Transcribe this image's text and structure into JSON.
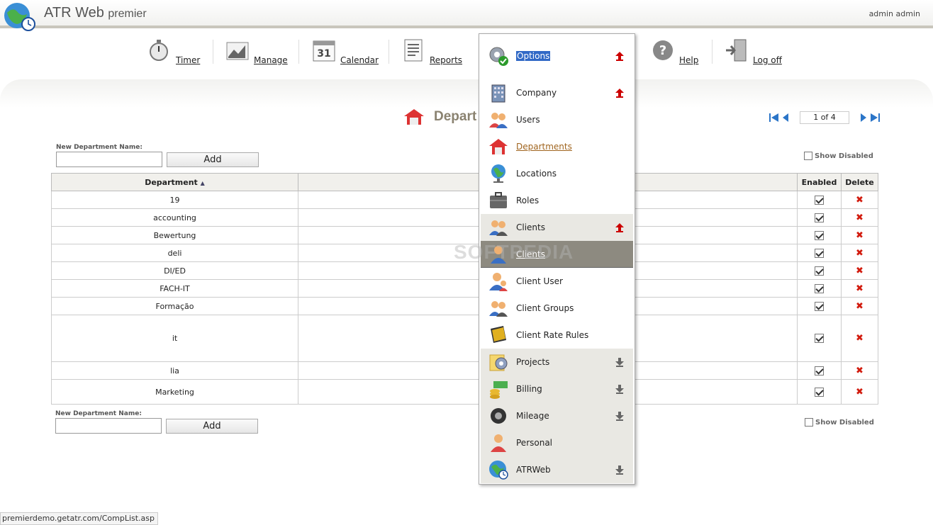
{
  "app": {
    "title": "ATR Web",
    "title_suffix": "premier",
    "user": "admin admin"
  },
  "nav": [
    {
      "label": "Timer",
      "icon": "stopwatch-icon"
    },
    {
      "label": "Manage",
      "icon": "chart-icon"
    },
    {
      "label": "Calendar",
      "icon": "calendar-icon",
      "icon_text": "31"
    },
    {
      "label": "Reports",
      "icon": "report-icon"
    },
    {
      "label": "Help",
      "icon": "help-icon",
      "icon_text": "?"
    },
    {
      "label": "Log off",
      "icon": "logoff-icon"
    }
  ],
  "page": {
    "title": "Depart",
    "pager_text": "1 of 4"
  },
  "form_top": {
    "label": "New Department Name:",
    "value": "",
    "add_label": "Add",
    "show_disabled": "Show Disabled"
  },
  "form_bottom": {
    "label": "New Department Name:",
    "value": "",
    "add_label": "Add",
    "show_disabled": "Show Disabled"
  },
  "table": {
    "headers": {
      "department": "Department",
      "enabled": "Enabled",
      "delete": "Delete"
    },
    "sort_indicator": "▲",
    "rows": [
      {
        "name": "19",
        "enabled": true,
        "delete": "✖"
      },
      {
        "name": "accounting",
        "enabled": true,
        "delete": "✖"
      },
      {
        "name": "Bewertung",
        "enabled": true,
        "delete": "✖"
      },
      {
        "name": "deli",
        "enabled": true,
        "delete": "✖"
      },
      {
        "name": "DI/ED",
        "enabled": true,
        "delete": "✖"
      },
      {
        "name": "FACH-IT",
        "enabled": true,
        "delete": "✖"
      },
      {
        "name": "Formação",
        "enabled": true,
        "delete": "✖"
      },
      {
        "name": "it",
        "enabled": true,
        "delete": "✖"
      },
      {
        "name": "lia",
        "enabled": true,
        "delete": "✖"
      },
      {
        "name": "Marketing",
        "enabled": true,
        "delete": "✖"
      }
    ]
  },
  "dropdown": {
    "items": [
      {
        "label": "Options",
        "icon": "gear-check-icon",
        "arrow": "up"
      },
      {
        "label": "Company",
        "icon": "building-icon",
        "arrow": "up"
      },
      {
        "label": "Users",
        "icon": "users-icon"
      },
      {
        "label": "Departments",
        "icon": "departments-icon"
      },
      {
        "label": "Locations",
        "icon": "globe-icon"
      },
      {
        "label": "Roles",
        "icon": "briefcase-icon"
      },
      {
        "label": "Clients",
        "icon": "clients-icon",
        "arrow": "up"
      },
      {
        "label": "Clients",
        "icon": "client-icon"
      },
      {
        "label": "Client User",
        "icon": "client-user-icon"
      },
      {
        "label": "Client Groups",
        "icon": "client-groups-icon"
      },
      {
        "label": "Client Rate Rules",
        "icon": "rate-book-icon"
      },
      {
        "label": "Projects",
        "icon": "projects-icon",
        "arrow": "down"
      },
      {
        "label": "Billing",
        "icon": "billing-icon",
        "arrow": "down"
      },
      {
        "label": "Mileage",
        "icon": "tire-icon",
        "arrow": "down"
      },
      {
        "label": "Personal",
        "icon": "person-icon"
      },
      {
        "label": "ATRWeb",
        "icon": "atrweb-globe-icon",
        "arrow": "down"
      }
    ]
  },
  "status_bar": {
    "url": "premierdemo.getatr.com/CompList.asp"
  },
  "watermark": "SOFTPEDIA",
  "colors": {
    "accent_red": "#d21b0e",
    "highlight_blue": "#3169c6",
    "title_brown": "#8a8270"
  }
}
